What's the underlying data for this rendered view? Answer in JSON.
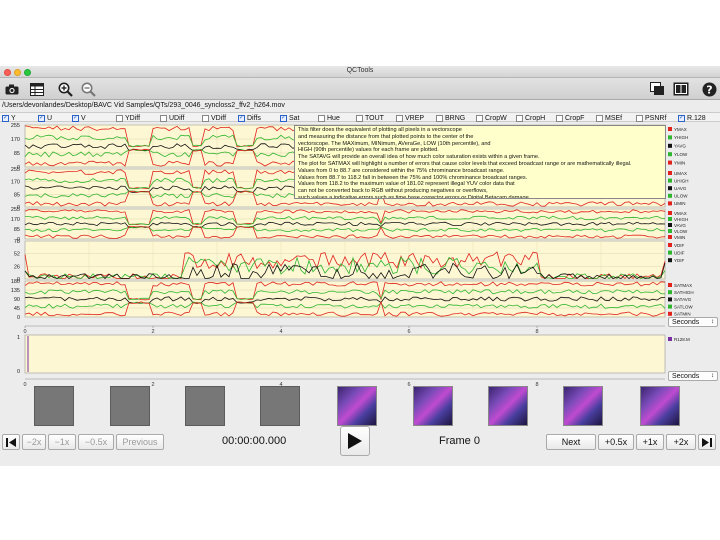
{
  "window": {
    "title": "QCTools"
  },
  "toolbar": {
    "icons": [
      "camera-icon",
      "table-icon",
      "zoom-in-icon",
      "zoom-out-icon",
      "layers-icon",
      "film-icon",
      "help-icon"
    ]
  },
  "file": {
    "path": "/Users/devonlandes/Desktop/BAVC Vid Samples/QTs/293_0046_syncloss2_ffv2_h264.mov"
  },
  "filters": [
    {
      "label": "Y",
      "checked": true
    },
    {
      "label": "U",
      "checked": true
    },
    {
      "label": "V",
      "checked": true
    },
    {
      "label": "YDiff",
      "checked": false
    },
    {
      "label": "UDiff",
      "checked": false
    },
    {
      "label": "VDiff",
      "checked": false
    },
    {
      "label": "Diffs",
      "checked": true
    },
    {
      "label": "Sat",
      "checked": true
    },
    {
      "label": "Hue",
      "checked": false
    },
    {
      "label": "TOUT",
      "checked": false
    },
    {
      "label": "VREP",
      "checked": false
    },
    {
      "label": "BRNG",
      "checked": false
    },
    {
      "label": "CropW",
      "checked": false
    },
    {
      "label": "CropH",
      "checked": false
    },
    {
      "label": "CropF",
      "checked": false
    },
    {
      "label": "MSEf",
      "checked": false
    },
    {
      "label": "PSNRf",
      "checked": false
    },
    {
      "label": "R.128",
      "checked": true
    }
  ],
  "graphs": [
    {
      "name": "Y",
      "yticks": [
        "255",
        "170",
        "85",
        "0"
      ],
      "legend": [
        {
          "label": "YMAX",
          "color": "#e0231d"
        },
        {
          "label": "YHIGH",
          "color": "#2fb52f"
        },
        {
          "label": "YAVG",
          "color": "#111111"
        },
        {
          "label": "YLOW",
          "color": "#2fb52f"
        },
        {
          "label": "YMIN",
          "color": "#e0231d"
        }
      ]
    },
    {
      "name": "U",
      "yticks": [
        "255",
        "170",
        "85",
        "0"
      ],
      "legend": [
        {
          "label": "UMAX",
          "color": "#e0231d"
        },
        {
          "label": "UHIGH",
          "color": "#2fb52f"
        },
        {
          "label": "UAVG",
          "color": "#111111"
        },
        {
          "label": "ULOW",
          "color": "#2fb52f"
        },
        {
          "label": "UMIN",
          "color": "#e0231d"
        }
      ]
    },
    {
      "name": "V",
      "yticks": [
        "255",
        "170",
        "85",
        "0"
      ],
      "legend": [
        {
          "label": "VMAX",
          "color": "#e0231d"
        },
        {
          "label": "VHIGH",
          "color": "#2fb52f"
        },
        {
          "label": "VAVG",
          "color": "#111111"
        },
        {
          "label": "VLOW",
          "color": "#2fb52f"
        },
        {
          "label": "VMIN",
          "color": "#e0231d"
        }
      ]
    },
    {
      "name": "Diffs",
      "yticks": [
        "78",
        "52",
        "26",
        "0"
      ],
      "legend": [
        {
          "label": "VDIF",
          "color": "#e0231d"
        },
        {
          "label": "UDIF",
          "color": "#2fb52f"
        },
        {
          "label": "YDIF",
          "color": "#111111"
        }
      ]
    },
    {
      "name": "Sat",
      "yticks": [
        "180",
        "135",
        "90",
        "45",
        "0"
      ],
      "legend": [
        {
          "label": "SATMAX",
          "color": "#e0231d"
        },
        {
          "label": "SATHIGH",
          "color": "#2fb52f"
        },
        {
          "label": "SATAVG",
          "color": "#111111"
        },
        {
          "label": "SATLOW",
          "color": "#2fb52f"
        },
        {
          "label": "SATMIN",
          "color": "#e0231d"
        }
      ]
    }
  ],
  "r128": {
    "yticks": [
      "1",
      "0"
    ],
    "legend": [
      {
        "label": "R128.M",
        "color": "#7a2fa0"
      }
    ]
  },
  "axis": {
    "ticks": [
      "0",
      "2",
      "4",
      "6",
      "8"
    ],
    "units": "Seconds"
  },
  "tooltip": [
    "This filter does the equivalent of plotting all pixels in a vectorscope",
    "and measuring the distance from that plotted points to the center of the",
    "vectorscope. The MAXimum, MINimum, AVeraGe, LOW (10th percentile), and",
    "HIGH (90th percentile) values for each frame are plotted.",
    "The SATAVG will provide an overall idea of how much color saturation exists within a given frame.",
    "The plot for SATMAX will highlight a number of errors that cause color levels that exceed broadcast range or are mathematically illegal.",
    "Values from 0 to 88.7 are considered within the 75% chrominance broadcast range.",
    "Values from 88.7 to 118.2 fall in between the 75% and 100% chrominance broadcast ranges.",
    "Values from 118.2 to the maximum value of 181.02 represent illegal YUV color data that",
    "can not be converted back to RGB without producing negatives or overflows,",
    "such values a indicative errors such as time base corrector errors or Digital Betacam damage."
  ],
  "transport": {
    "rewind_buttons": [
      "−2x",
      "−1x",
      "−0.5x",
      "Previous"
    ],
    "timecode": "00:00:00.000",
    "frame": "Frame 0",
    "next": "Next",
    "forward_buttons": [
      "+0.5x",
      "+1x",
      "+2x"
    ]
  },
  "thumbnails": [
    {
      "kind": "blank"
    },
    {
      "kind": "blank"
    },
    {
      "kind": "blank"
    },
    {
      "kind": "blank"
    },
    {
      "kind": "image"
    },
    {
      "kind": "image"
    },
    {
      "kind": "image"
    },
    {
      "kind": "image"
    },
    {
      "kind": "image"
    }
  ],
  "colors": {
    "plot_bg": "#fdf7d3",
    "red": "#e0231d",
    "green": "#2fb52f",
    "black": "#111111",
    "purple": "#7a2fa0"
  }
}
